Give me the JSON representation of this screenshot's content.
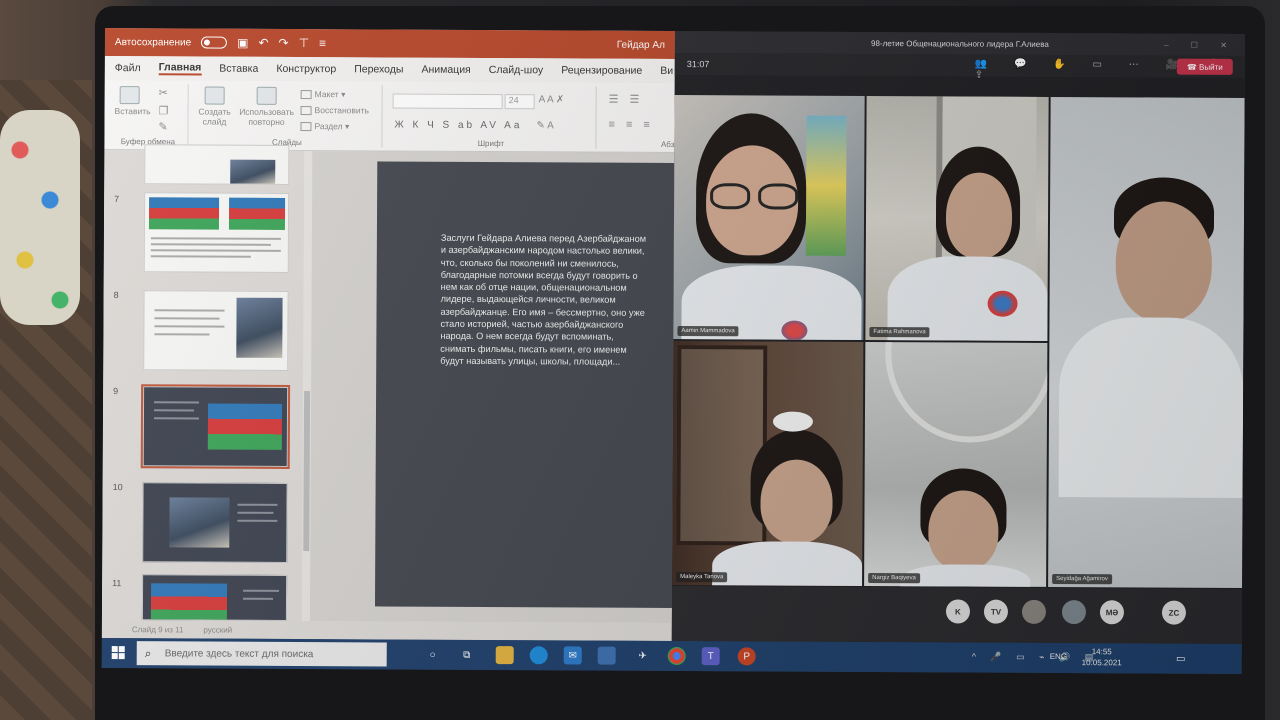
{
  "powerpoint": {
    "autosave_label": "Автосохранение",
    "doc_title": "Гейдар Ал",
    "tabs": [
      "Файл",
      "Главная",
      "Вставка",
      "Конструктор",
      "Переходы",
      "Анимация",
      "Слайд-шоу",
      "Рецензирование",
      "Ви"
    ],
    "active_tab": "Главная",
    "ribbon": {
      "paste": "Вставить",
      "clipboard_group": "Буфер обмена",
      "new_slide": "Создать слайд",
      "reuse": "Использовать повторно",
      "layout": "Макет",
      "reset": "Восстановить",
      "section": "Раздел",
      "slides_group": "Слайды",
      "font_size": "24",
      "font_group": "Шрифт",
      "paragraph_group": "Абз",
      "format_buttons": "Ж К Ч S ab AV Aa"
    },
    "thumbnails": [
      {
        "number": "7"
      },
      {
        "number": "8"
      },
      {
        "number": "9"
      },
      {
        "number": "10"
      },
      {
        "number": "11"
      }
    ],
    "slide_text": "Заслуги Гейдара Алиева перед Азербайджаном и азербайджанским народом настолько велики, что, сколько бы поколений ни сменилось, благодарные потомки всегда будут говорить о нем как об отце нации, общенациональном лидере, выдающейся личности, великом азербайджанце. Его имя – бессмертно, оно уже стало историей, частью азербайджанского народа. О нем всегда будут вспоминать, снимать фильмы, писать книги, его именем будут называть улицы, школы, площади...",
    "status_slide": "Слайд 9 из 11",
    "status_lang": "русский"
  },
  "teams": {
    "window_title": "98-летие Общенационального лидера Г.Алиева",
    "timer": "31:07",
    "leave_label": "Выйти",
    "participants": [
      {
        "name": "Aamin Mammadova"
      },
      {
        "name": "Fatima Rahmanova"
      },
      {
        "name": "Maleyka Tanova"
      },
      {
        "name": "Nargiz Baqiyeva"
      },
      {
        "name": "Seyidağa Ağamirov"
      }
    ],
    "avatars": [
      "K",
      "TV",
      "MƏ",
      "ZC"
    ]
  },
  "taskbar": {
    "search_placeholder": "Введите здесь текст для поиска",
    "lang": "ENG",
    "time": "14:55",
    "date": "10.05.2021"
  }
}
